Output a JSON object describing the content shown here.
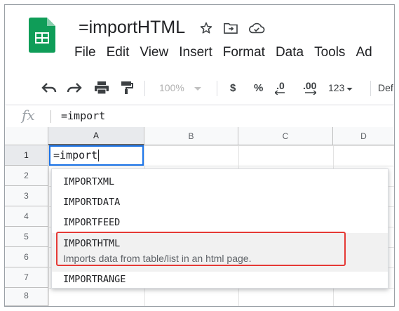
{
  "document": {
    "title": "=importHTML"
  },
  "title_icons": [
    "star-icon",
    "move-to-folder-icon",
    "cloud-status-icon"
  ],
  "menu": [
    "File",
    "Edit",
    "View",
    "Insert",
    "Format",
    "Data",
    "Tools",
    "Ad"
  ],
  "toolbar": {
    "zoom": "100%",
    "currency": "$",
    "percent": "%",
    "decrease_decimal": ".0",
    "increase_decimal": ".00",
    "more_formats": "123",
    "font_partial": "Def"
  },
  "formula_bar": {
    "fx_label": "fx",
    "value": "=import"
  },
  "columns": [
    "A",
    "B",
    "C",
    "D"
  ],
  "rows": [
    "1",
    "2",
    "3",
    "4",
    "5",
    "6",
    "7",
    "8"
  ],
  "active_cell": {
    "value": "=import"
  },
  "autocomplete": {
    "options": [
      {
        "name": "IMPORTXML"
      },
      {
        "name": "IMPORTDATA"
      },
      {
        "name": "IMPORTFEED"
      },
      {
        "name": "IMPORTHTML",
        "description": "Imports data from table/list in an html page."
      },
      {
        "name": "IMPORTRANGE"
      }
    ]
  },
  "colors": {
    "sheets_green": "#0f9d58",
    "selection_blue": "#1a73e8",
    "highlight_red": "#e53935"
  }
}
